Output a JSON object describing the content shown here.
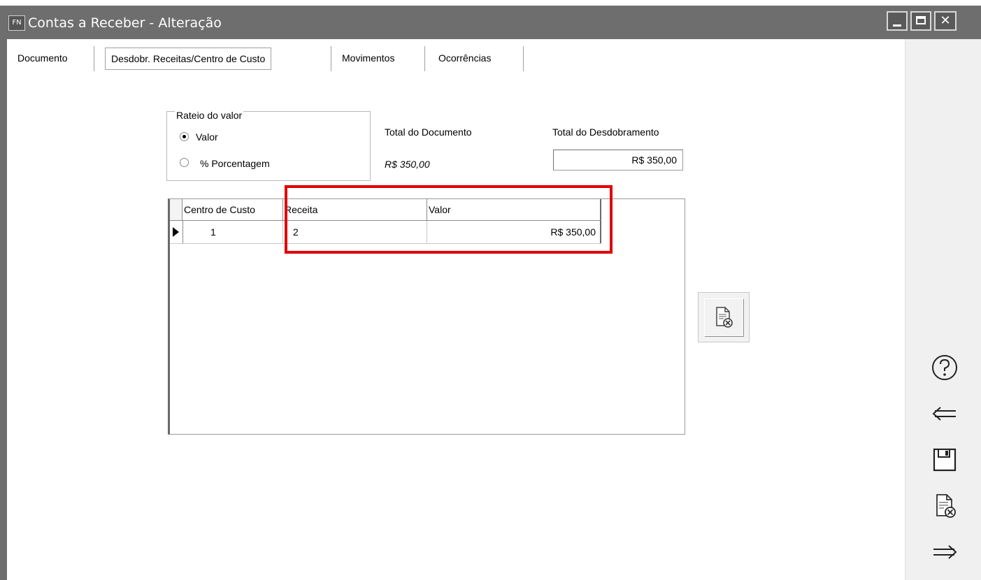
{
  "window": {
    "app_badge": "FN",
    "title": "Contas a Receber - Alteração"
  },
  "tabs": [
    {
      "label": "Documento"
    },
    {
      "label": "Desdobr. Receitas/Centro de Custo"
    },
    {
      "label": "Movimentos"
    },
    {
      "label": "Ocorrências"
    }
  ],
  "rateio": {
    "legend": "Rateio do valor",
    "options": [
      {
        "label": "Valor",
        "selected": true
      },
      {
        "label": "% Porcentagem",
        "selected": false
      }
    ]
  },
  "totals": {
    "documento_label": "Total do Documento",
    "documento_value": "R$ 350,00",
    "desdobramento_label": "Total do Desdobramento",
    "desdobramento_value": "R$ 350,00"
  },
  "grid": {
    "columns": [
      "Centro de Custo",
      "Receita",
      "Valor"
    ],
    "rows": [
      {
        "centro_de_custo": "1",
        "receita": "2",
        "valor": "R$ 350,00"
      }
    ]
  },
  "icons": {
    "delete_row": "document-delete-icon",
    "side": [
      "help-icon",
      "back-arrow-icon",
      "save-icon",
      "document-delete-icon",
      "forward-arrow-icon"
    ]
  },
  "colors": {
    "titlebar": "#6e6e6e",
    "highlight": "#e00000"
  }
}
